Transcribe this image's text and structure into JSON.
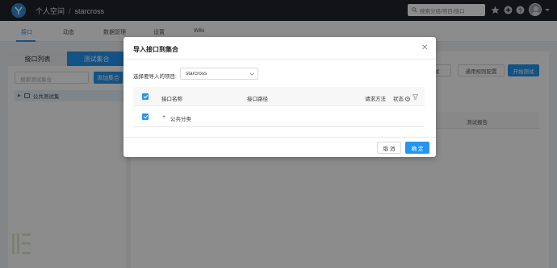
{
  "header": {
    "breadcrumb": [
      "个人空间",
      "starcross"
    ],
    "search_placeholder": "搜索分组/项目/接口"
  },
  "nav": {
    "tabs": [
      "接口",
      "动态",
      "数据管理",
      "设置",
      "Wiki"
    ],
    "active": "接口"
  },
  "left_panel": {
    "tabs": [
      "接口列表",
      "测试集合"
    ],
    "active_tab": "测试集合",
    "search_placeholder": "搜索测试集合",
    "add_button": "添加集合",
    "tree": [
      {
        "label": "公共测试集"
      }
    ]
  },
  "right_panel": {
    "buttons": [
      "服务端测试",
      "通用规则配置",
      "开始测试"
    ],
    "header_columns": [
      "测试报告"
    ]
  },
  "modal": {
    "title": "导入接口到集合",
    "project_label": "选择要导入的项目:",
    "project_value": "starcross",
    "columns": [
      "接口名称",
      "接口路径",
      "请求方法",
      "状态"
    ],
    "rows": [
      {
        "name": "公共分类",
        "checked": true
      }
    ],
    "cancel": "取 消",
    "ok": "确 定"
  },
  "colors": {
    "accent": "#2395f1",
    "topbar": "#1f2329"
  }
}
